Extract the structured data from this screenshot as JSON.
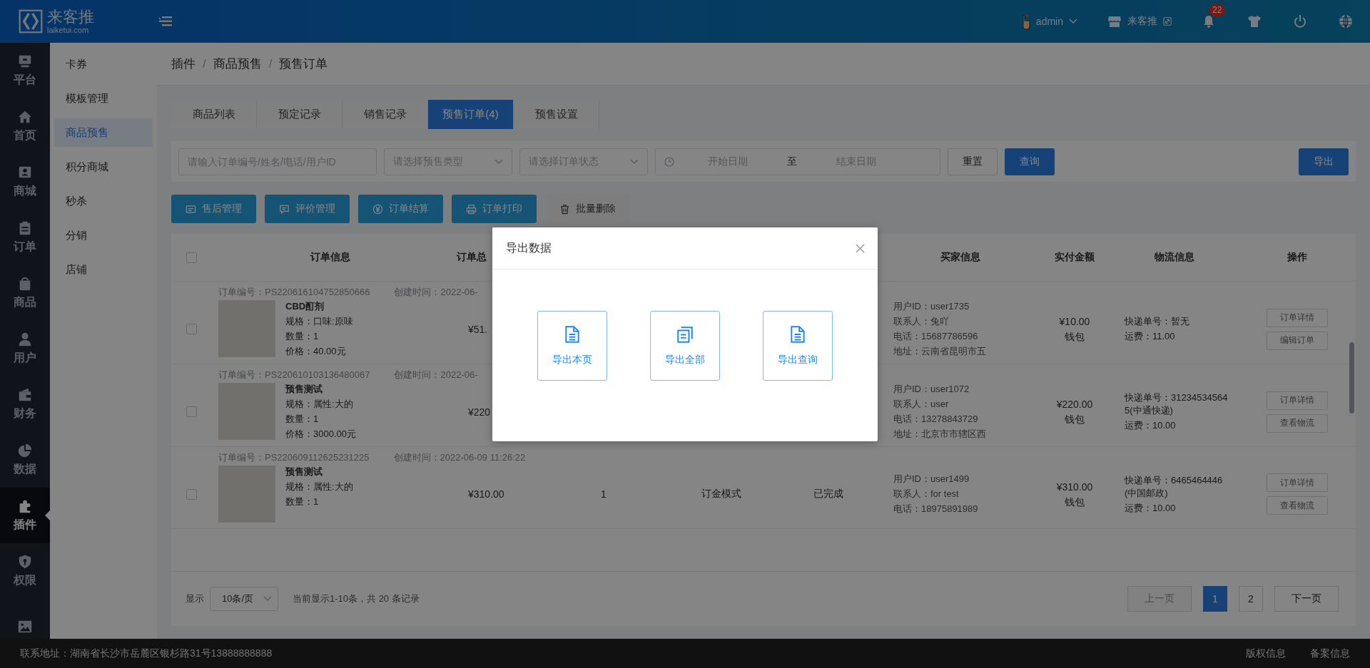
{
  "header": {
    "logo_text": "来客推",
    "logo_subtext": "laiketui.com",
    "user": "admin",
    "shop": "来客推",
    "notification_count": "22"
  },
  "nav": [
    {
      "label": "平台",
      "selected": false
    },
    {
      "label": "首页",
      "selected": false
    },
    {
      "label": "商城",
      "selected": false
    },
    {
      "label": "订单",
      "selected": false
    },
    {
      "label": "商品",
      "selected": false
    },
    {
      "label": "用户",
      "selected": false
    },
    {
      "label": "财务",
      "selected": false
    },
    {
      "label": "数据",
      "selected": false
    },
    {
      "label": "插件",
      "selected": true
    },
    {
      "label": "权限",
      "selected": false
    },
    {
      "selected": false
    }
  ],
  "subnav": [
    {
      "label": "卡券",
      "selected": false
    },
    {
      "label": "模板管理",
      "selected": false
    },
    {
      "label": "商品预售",
      "selected": true
    },
    {
      "label": "积分商城",
      "selected": false
    },
    {
      "label": "秒杀",
      "selected": false
    },
    {
      "label": "分销",
      "selected": false
    },
    {
      "label": "店铺",
      "selected": false
    }
  ],
  "breadcrumb": {
    "items": [
      "插件",
      "商品预售",
      "预售订单"
    ],
    "separator": "/"
  },
  "tabs": [
    {
      "label": "商品列表",
      "selected": false
    },
    {
      "label": "预定记录",
      "selected": false
    },
    {
      "label": "销售记录",
      "selected": false
    },
    {
      "label": "预售订单(4)",
      "selected": true
    },
    {
      "label": "预售设置",
      "selected": false
    }
  ],
  "filters": {
    "keyword": {
      "placeholder": "请输入订单编号/姓名/电话/用户ID"
    },
    "presale_type": {
      "placeholder": "请选择预售类型"
    },
    "order_status": {
      "placeholder": "请选择订单状态"
    },
    "date_range": {
      "start_placeholder": "开始日期",
      "separator": "至",
      "end_placeholder": "结束日期"
    },
    "reset": "重置",
    "search": "查询",
    "export": "导出"
  },
  "actions": [
    {
      "label": "售后管理",
      "kind": "primary"
    },
    {
      "label": "评价管理",
      "kind": "primary"
    },
    {
      "label": "订单结算",
      "kind": "primary"
    },
    {
      "label": "订单打印",
      "kind": "primary"
    },
    {
      "label": "批量删除",
      "kind": "plain"
    }
  ],
  "table": {
    "select_all": {
      "checked": false
    },
    "columns": [
      "订单信息",
      "订单总",
      "买家信息",
      "实付金额",
      "物流信息",
      "操作"
    ],
    "rows": [
      {
        "checked": false,
        "order_no": "订单编号：PS220616104752850666",
        "created": "创建时间：2022-06-",
        "product": "CBD酊剂",
        "specs": [
          "规格：口味:原味",
          "数量：1",
          "价格：40.00元"
        ],
        "total": "¥51.",
        "buyer": [
          "用户ID：user1735",
          "联系人：兔吖",
          "电话：15687786596",
          "地址：云南省昆明市五"
        ],
        "paid": "¥10.00",
        "pay_method": "钱包",
        "logistics": [
          "快递单号：暂无",
          "运费：11.00"
        ],
        "ops": [
          "订单详情",
          "编辑订单"
        ]
      },
      {
        "checked": false,
        "order_no": "订单编号：PS220610103136480067",
        "created": "创建时间：2022-06-",
        "product": "预售测试",
        "specs": [
          "规格：属性:大的",
          "数量：1",
          "价格：3000.00元"
        ],
        "total": "¥220",
        "buyer": [
          "用户ID：user1072",
          "联系人：user",
          "电话：13278843729",
          "地址：北京市市辖区西"
        ],
        "paid": "¥220.00",
        "pay_method": "钱包",
        "logistics": [
          "快递单号：312345345645(中通快递)",
          "运费：10.00"
        ],
        "ops": [
          "订单详情",
          "查看物流"
        ]
      },
      {
        "checked": false,
        "order_no": "订单编号：PS220609112625231225",
        "created": "创建时间：2022-06-09 11:26:22",
        "product": "预售测试",
        "specs": [
          "规格：属性:大的",
          "数量：1"
        ],
        "total": "¥310.00",
        "quantity": "1",
        "mode": "订金模式",
        "status": "已完成",
        "buyer": [
          "用户ID：user1499",
          "联系人：for test",
          "电话：18975891989"
        ],
        "paid": "¥310.00",
        "pay_method": "钱包",
        "logistics": [
          "快递单号：6465464446(中国邮政)",
          "运费：10.00"
        ],
        "ops": [
          "订单详情",
          "查看物流"
        ]
      }
    ]
  },
  "pagination": {
    "page_size_label": "显示",
    "page_size": "10条/页",
    "summary": "当前显示1-10条，共 20 条记录",
    "prev": "上一页",
    "prev_disabled": true,
    "pages": [
      {
        "label": "1",
        "selected": true
      },
      {
        "label": "2",
        "selected": false
      }
    ],
    "next": "下一页"
  },
  "footer": {
    "contact": "联系地址：湖南省长沙市岳麓区银杉路31号13888888888",
    "links": [
      "版权信息",
      "备案信息"
    ]
  },
  "modal": {
    "title": "导出数据",
    "options": [
      "导出本页",
      "导出全部",
      "导出查询"
    ]
  }
}
